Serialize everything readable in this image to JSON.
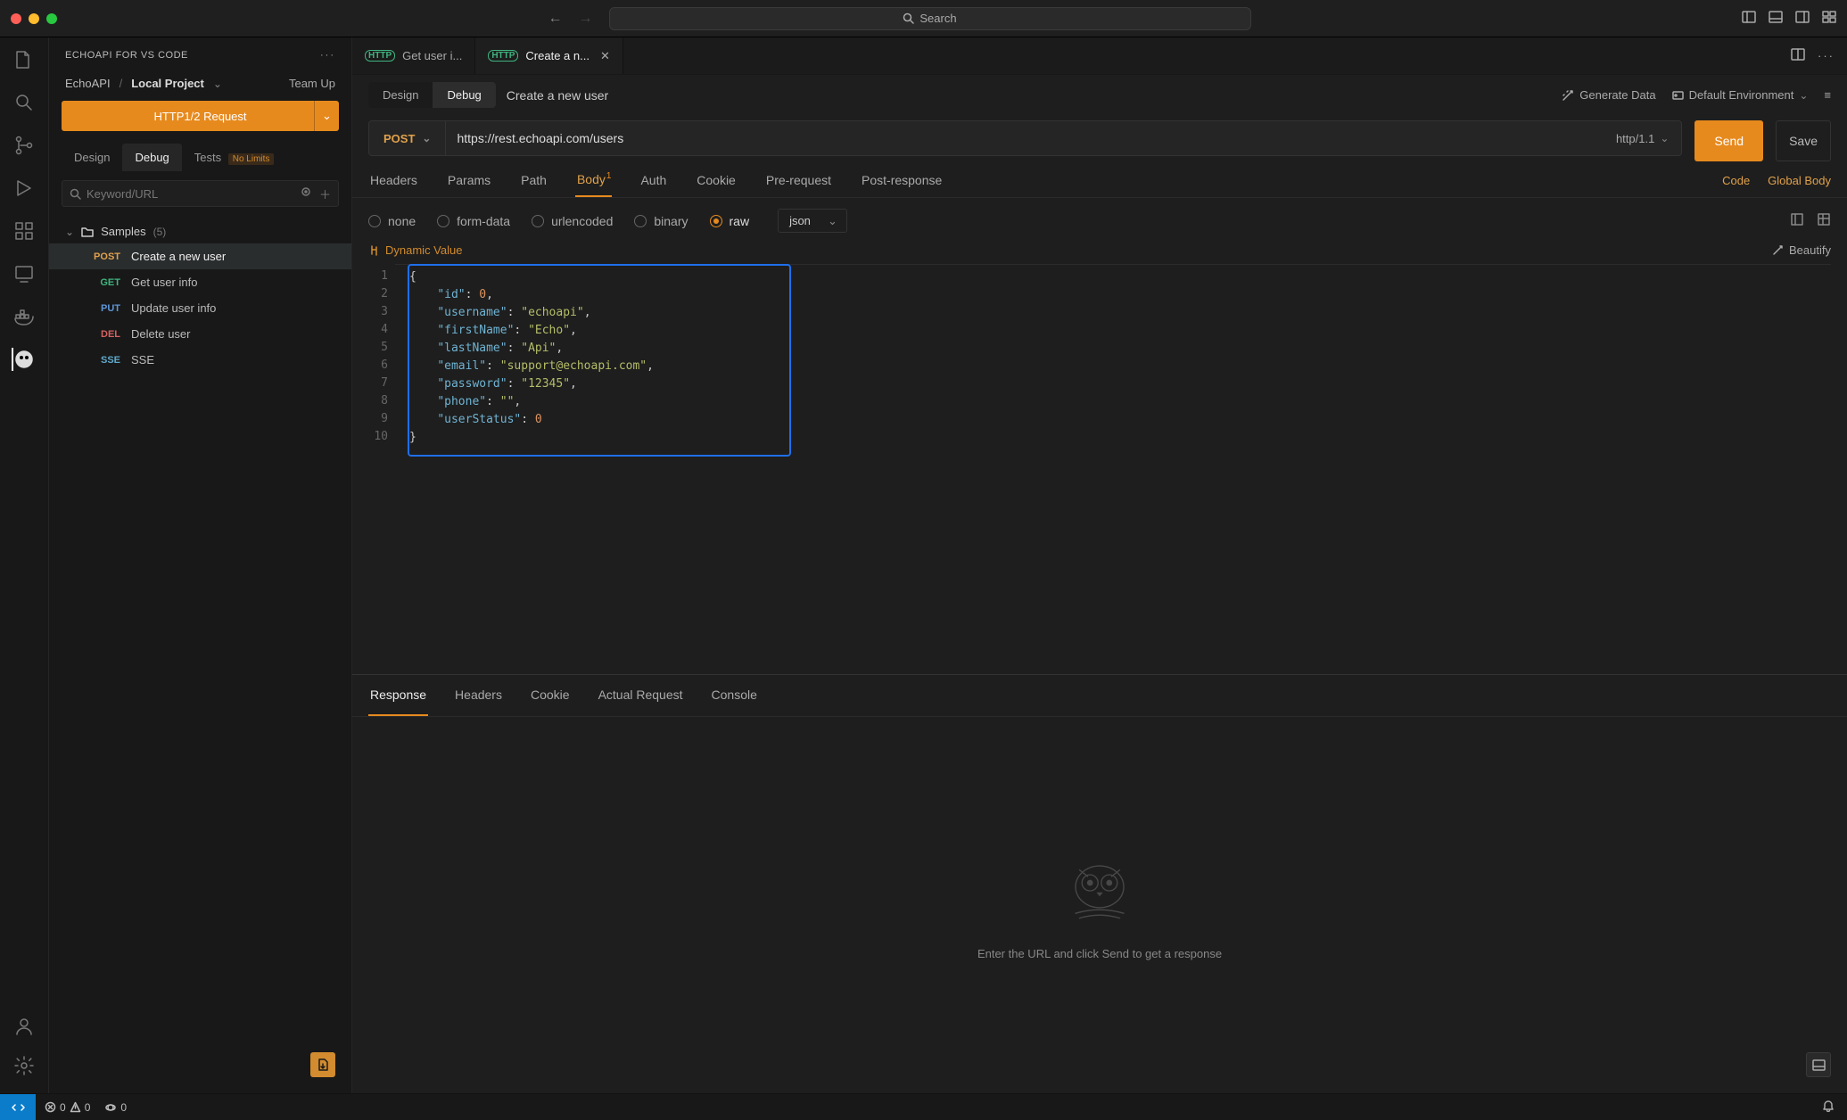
{
  "titlebar": {
    "search_placeholder": "Search"
  },
  "sidebar": {
    "title": "ECHOAPI FOR VS CODE",
    "breadcrumb": {
      "root": "EchoAPI",
      "sep": "/",
      "project": "Local Project"
    },
    "teamup": "Team Up",
    "http_btn": "HTTP1/2 Request",
    "tabs": {
      "design": "Design",
      "debug": "Debug",
      "tests": "Tests",
      "nolimits": "No Limits"
    },
    "search_placeholder": "Keyword/URL",
    "group": {
      "name": "Samples",
      "count": "(5)"
    },
    "items": [
      {
        "method": "POST",
        "mclass": "m-post",
        "label": "Create a new user",
        "selected": true
      },
      {
        "method": "GET",
        "mclass": "m-get",
        "label": "Get user info"
      },
      {
        "method": "PUT",
        "mclass": "m-put",
        "label": "Update user info"
      },
      {
        "method": "DEL",
        "mclass": "m-del",
        "label": "Delete user"
      },
      {
        "method": "SSE",
        "mclass": "m-sse",
        "label": "SSE"
      }
    ]
  },
  "tabs": [
    {
      "icon": "http",
      "label": "Get user i...",
      "active": false,
      "closable": false
    },
    {
      "icon": "http",
      "label": "Create a n...",
      "active": true,
      "closable": true
    }
  ],
  "subheader": {
    "design": "Design",
    "debug": "Debug",
    "title": "Create a new user",
    "generate": "Generate Data",
    "env": "Default Environment"
  },
  "request": {
    "method": "POST",
    "url": "https://rest.echoapi.com/users",
    "httpver": "http/1.1",
    "send": "Send",
    "save": "Save"
  },
  "reqtabs": {
    "headers": "Headers",
    "params": "Params",
    "path": "Path",
    "body": "Body",
    "auth": "Auth",
    "cookie": "Cookie",
    "prereq": "Pre-request",
    "postresp": "Post-response",
    "code": "Code",
    "globalbody": "Global Body"
  },
  "bodyopts": {
    "none": "none",
    "formdata": "form-data",
    "urlencoded": "urlencoded",
    "binary": "binary",
    "raw": "raw",
    "contenttype": "json"
  },
  "dynamic": {
    "label": "Dynamic Value",
    "beautify": "Beautify"
  },
  "code": {
    "lines": 10,
    "body": {
      "id": 0,
      "username": "echoapi",
      "firstName": "Echo",
      "lastName": "Api",
      "email": "support@echoapi.com",
      "password": "12345",
      "phone": "",
      "userStatus": 0
    }
  },
  "response": {
    "tabs": {
      "response": "Response",
      "headers": "Headers",
      "cookie": "Cookie",
      "actual": "Actual Request",
      "console": "Console"
    },
    "empty": "Enter the URL and click Send to get a response"
  },
  "status": {
    "errors": "0",
    "warnings": "0",
    "ports": "0"
  }
}
